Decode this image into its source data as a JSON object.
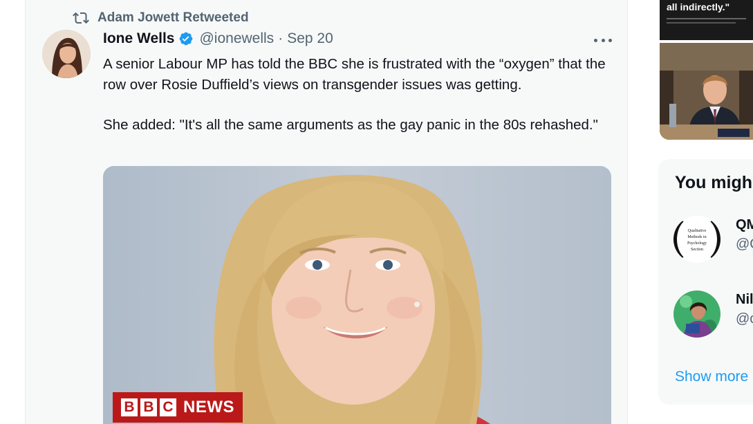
{
  "retweet": {
    "label": "Adam Jowett Retweeted"
  },
  "tweet": {
    "author_name": "Ione Wells",
    "handle": "@ionewells",
    "separator": "·",
    "date": "Sep 20",
    "paragraphs": [
      "A senior Labour MP has told the BBC she is frustrated with the “oxygen” that the row over Rosie Duffield’s views on transgender issues was getting.",
      "She added: \"It's all the same arguments as the gay panic in the 80s rehashed.\""
    ],
    "media_badge": {
      "letters": [
        "B",
        "B",
        "C"
      ],
      "word": "NEWS"
    }
  },
  "sidebar": {
    "top_thumbnail_quote": "all indirectly.\"",
    "follow_title": "You migh",
    "suggestions": [
      {
        "name": "QM",
        "handle": "@Q",
        "avatar_text": [
          "Qualitative",
          "Methods in",
          "Psychology",
          "Section"
        ]
      },
      {
        "name": "Nil",
        "handle": "@c"
      }
    ],
    "show_more": "Show more"
  },
  "colors": {
    "accent": "#1d9bf0",
    "text_secondary": "#536471",
    "bbc_red": "#bb1919"
  }
}
